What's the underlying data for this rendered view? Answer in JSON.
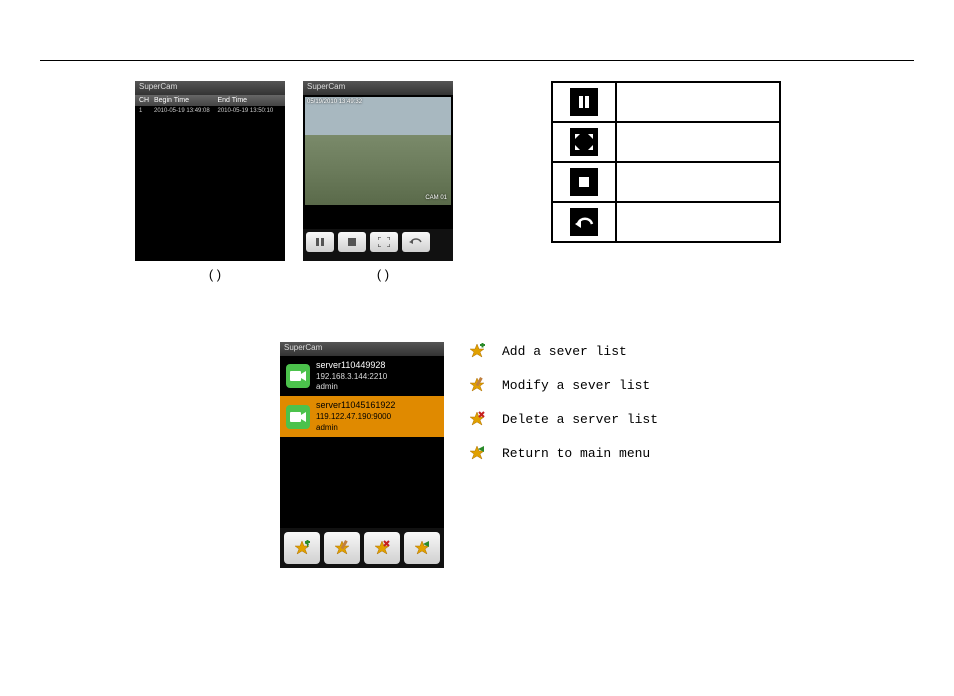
{
  "phone_record_list": {
    "title": "SuperCam",
    "cols": [
      "CH",
      "Begin Time",
      "End Time"
    ],
    "rows": [
      {
        "ch": "1",
        "begin": "2010-05-19 13:49:08",
        "end": "2010-05-19 13:50:10"
      }
    ],
    "caption": "(    )"
  },
  "phone_playback": {
    "title": "SuperCam",
    "osd_top": "05/19/2010 13:49:32",
    "osd_bottom": "CAM 01",
    "caption": "(    )"
  },
  "icon_table": {
    "pause": "",
    "fullscreen": "",
    "stop": "",
    "back": ""
  },
  "phone_serverlist": {
    "title": "SuperCam",
    "servers": [
      {
        "name": "server110449928",
        "addr": "192.168.3.144:2210",
        "user": "admin"
      },
      {
        "name": "server11045161922",
        "addr": "119.122.47.190:9000",
        "user": "admin"
      }
    ]
  },
  "legend": {
    "add": "Add a sever list",
    "modify": "Modify a sever list",
    "delete": "Delete a server list",
    "return": "Return to main menu"
  }
}
